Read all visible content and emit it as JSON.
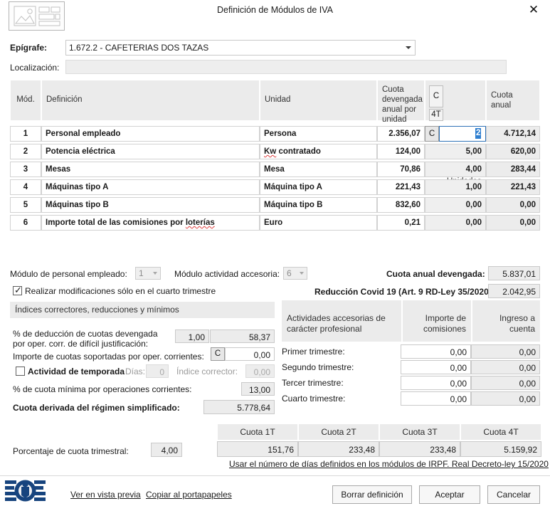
{
  "window": {
    "title": "Definición de Módulos de IVA",
    "close_label": "✕",
    "app_icon": "report-layout-icon"
  },
  "form": {
    "epigrafe_label": "Epígrafe:",
    "epigrafe_value": "1.672.2 - CAFETERIAS DOS TAZAS",
    "localizacion_label": "Localización:",
    "localizacion_value": ""
  },
  "grid": {
    "headers": {
      "mod": "Mód.",
      "definicion": "Definición",
      "unidad": "Unidad",
      "cuota_unidad": "Cuota devengada anual por unidad",
      "c_button": "C",
      "fourt_button": "4T",
      "unidades": "Unidades",
      "cuota_anual": "Cuota anual"
    },
    "rows": [
      {
        "mod": "1",
        "definicion": "Personal empleado",
        "unidad": "Persona",
        "cuota_unidad": "2.356,07",
        "c": "C",
        "unidades": "2",
        "cuota_anual": "4.712,14",
        "selected": true
      },
      {
        "mod": "2",
        "definicion": "Potencia eléctrica",
        "unidad": "Kw contratado",
        "cuota_unidad": "124,00",
        "c": "",
        "unidades": "5,00",
        "cuota_anual": "620,00",
        "selected": false
      },
      {
        "mod": "3",
        "definicion": "Mesas",
        "unidad": "Mesa",
        "cuota_unidad": "70,86",
        "c": "",
        "unidades": "4,00",
        "cuota_anual": "283,44",
        "selected": false
      },
      {
        "mod": "4",
        "definicion": "Máquinas tipo A",
        "unidad": "Máquina tipo A",
        "cuota_unidad": "221,43",
        "c": "",
        "unidades": "1,00",
        "cuota_anual": "221,43",
        "selected": false
      },
      {
        "mod": "5",
        "definicion": "Máquinas tipo B",
        "unidad": "Máquina tipo B",
        "cuota_unidad": "832,60",
        "c": "",
        "unidades": "0,00",
        "cuota_anual": "0,00",
        "selected": false
      },
      {
        "mod": "6",
        "definicion": "Importe total de las comisiones por loterías",
        "unidad": "Euro",
        "cuota_unidad": "0,21",
        "c": "",
        "unidades": "0,00",
        "cuota_anual": "0,00",
        "selected": false
      }
    ]
  },
  "left_panel": {
    "modulo_personal_label": "Módulo de personal empleado:",
    "modulo_personal_value": "1",
    "modulo_accesoria_label": "Módulo actividad accesoria:",
    "modulo_accesoria_value": "6",
    "cuarto_trimestre_label": "Realizar modificaciones sólo en el cuarto trimestre",
    "cuarto_trimestre_checked": true,
    "section_title": "Índices correctores, reducciones y mínimos",
    "deduccion_label_l1": "% de deducción de cuotas devengada",
    "deduccion_label_l2": "por oper. corr. de difícil justificación:",
    "deduccion_pct": "1,00",
    "deduccion_amount": "58,37",
    "soportadas_label": "Importe de cuotas soportadas por oper. corrientes:",
    "soportadas_c": "C",
    "soportadas_value": "0,00",
    "temporada_label": "Actividad de temporada",
    "temporada_checked": false,
    "dias_label": "Días:",
    "dias_value": "0",
    "indice_corrector_label": "Índice corrector:",
    "indice_corrector_value": "0,00",
    "cuota_minima_label": "% de cuota mínima por operaciones corrientes:",
    "cuota_minima_value": "13,00",
    "cuota_derivada_label": "Cuota derivada del régimen simplificado:",
    "cuota_derivada_value": "5.778,64",
    "porcentaje_trimestral_label": "Porcentaje de cuota trimestral:",
    "porcentaje_trimestral_value": "4,00"
  },
  "right_panel": {
    "cuota_anual_devengada_label": "Cuota anual devengada:",
    "cuota_anual_devengada_value": "5.837,01",
    "reduccion_label": "Reducción Covid 19 (Art. 9 RD-Ley 35/2020):",
    "reduccion_value": "2.042,95",
    "table_headers": {
      "actividades": "Actividades accesorias de carácter profesional",
      "importe": "Importe de comisiones",
      "ingreso": "Ingreso a cuenta"
    },
    "rows": [
      {
        "label": "Primer trimestre:",
        "importe": "0,00",
        "ingreso": "0,00"
      },
      {
        "label": "Segundo trimestre:",
        "importe": "0,00",
        "ingreso": "0,00"
      },
      {
        "label": "Tercer trimestre:",
        "importe": "0,00",
        "ingreso": "0,00"
      },
      {
        "label": "Cuarto trimestre:",
        "importe": "0,00",
        "ingreso": "0,00"
      }
    ]
  },
  "quarter_table": {
    "headers": [
      "Cuota 1T",
      "Cuota 2T",
      "Cuota 3T",
      "Cuota 4T"
    ],
    "values": [
      "151,76",
      "233,48",
      "233,48",
      "5.159,92"
    ],
    "note_link": "Usar el número de días definidos en los módulos de IRPF. Real Decreto-ley 15/2020"
  },
  "footer": {
    "logo": "boe-logo",
    "link_preview": "Ver en vista previa",
    "link_clipboard": "Copiar al portapapeles",
    "btn_borrar": "Borrar definición",
    "btn_aceptar": "Aceptar",
    "btn_cancelar": "Cancelar"
  },
  "colors": {
    "selection_blue": "#2f7fd0",
    "header_grey": "#ebebeb",
    "boe_blue": "#17447e"
  }
}
